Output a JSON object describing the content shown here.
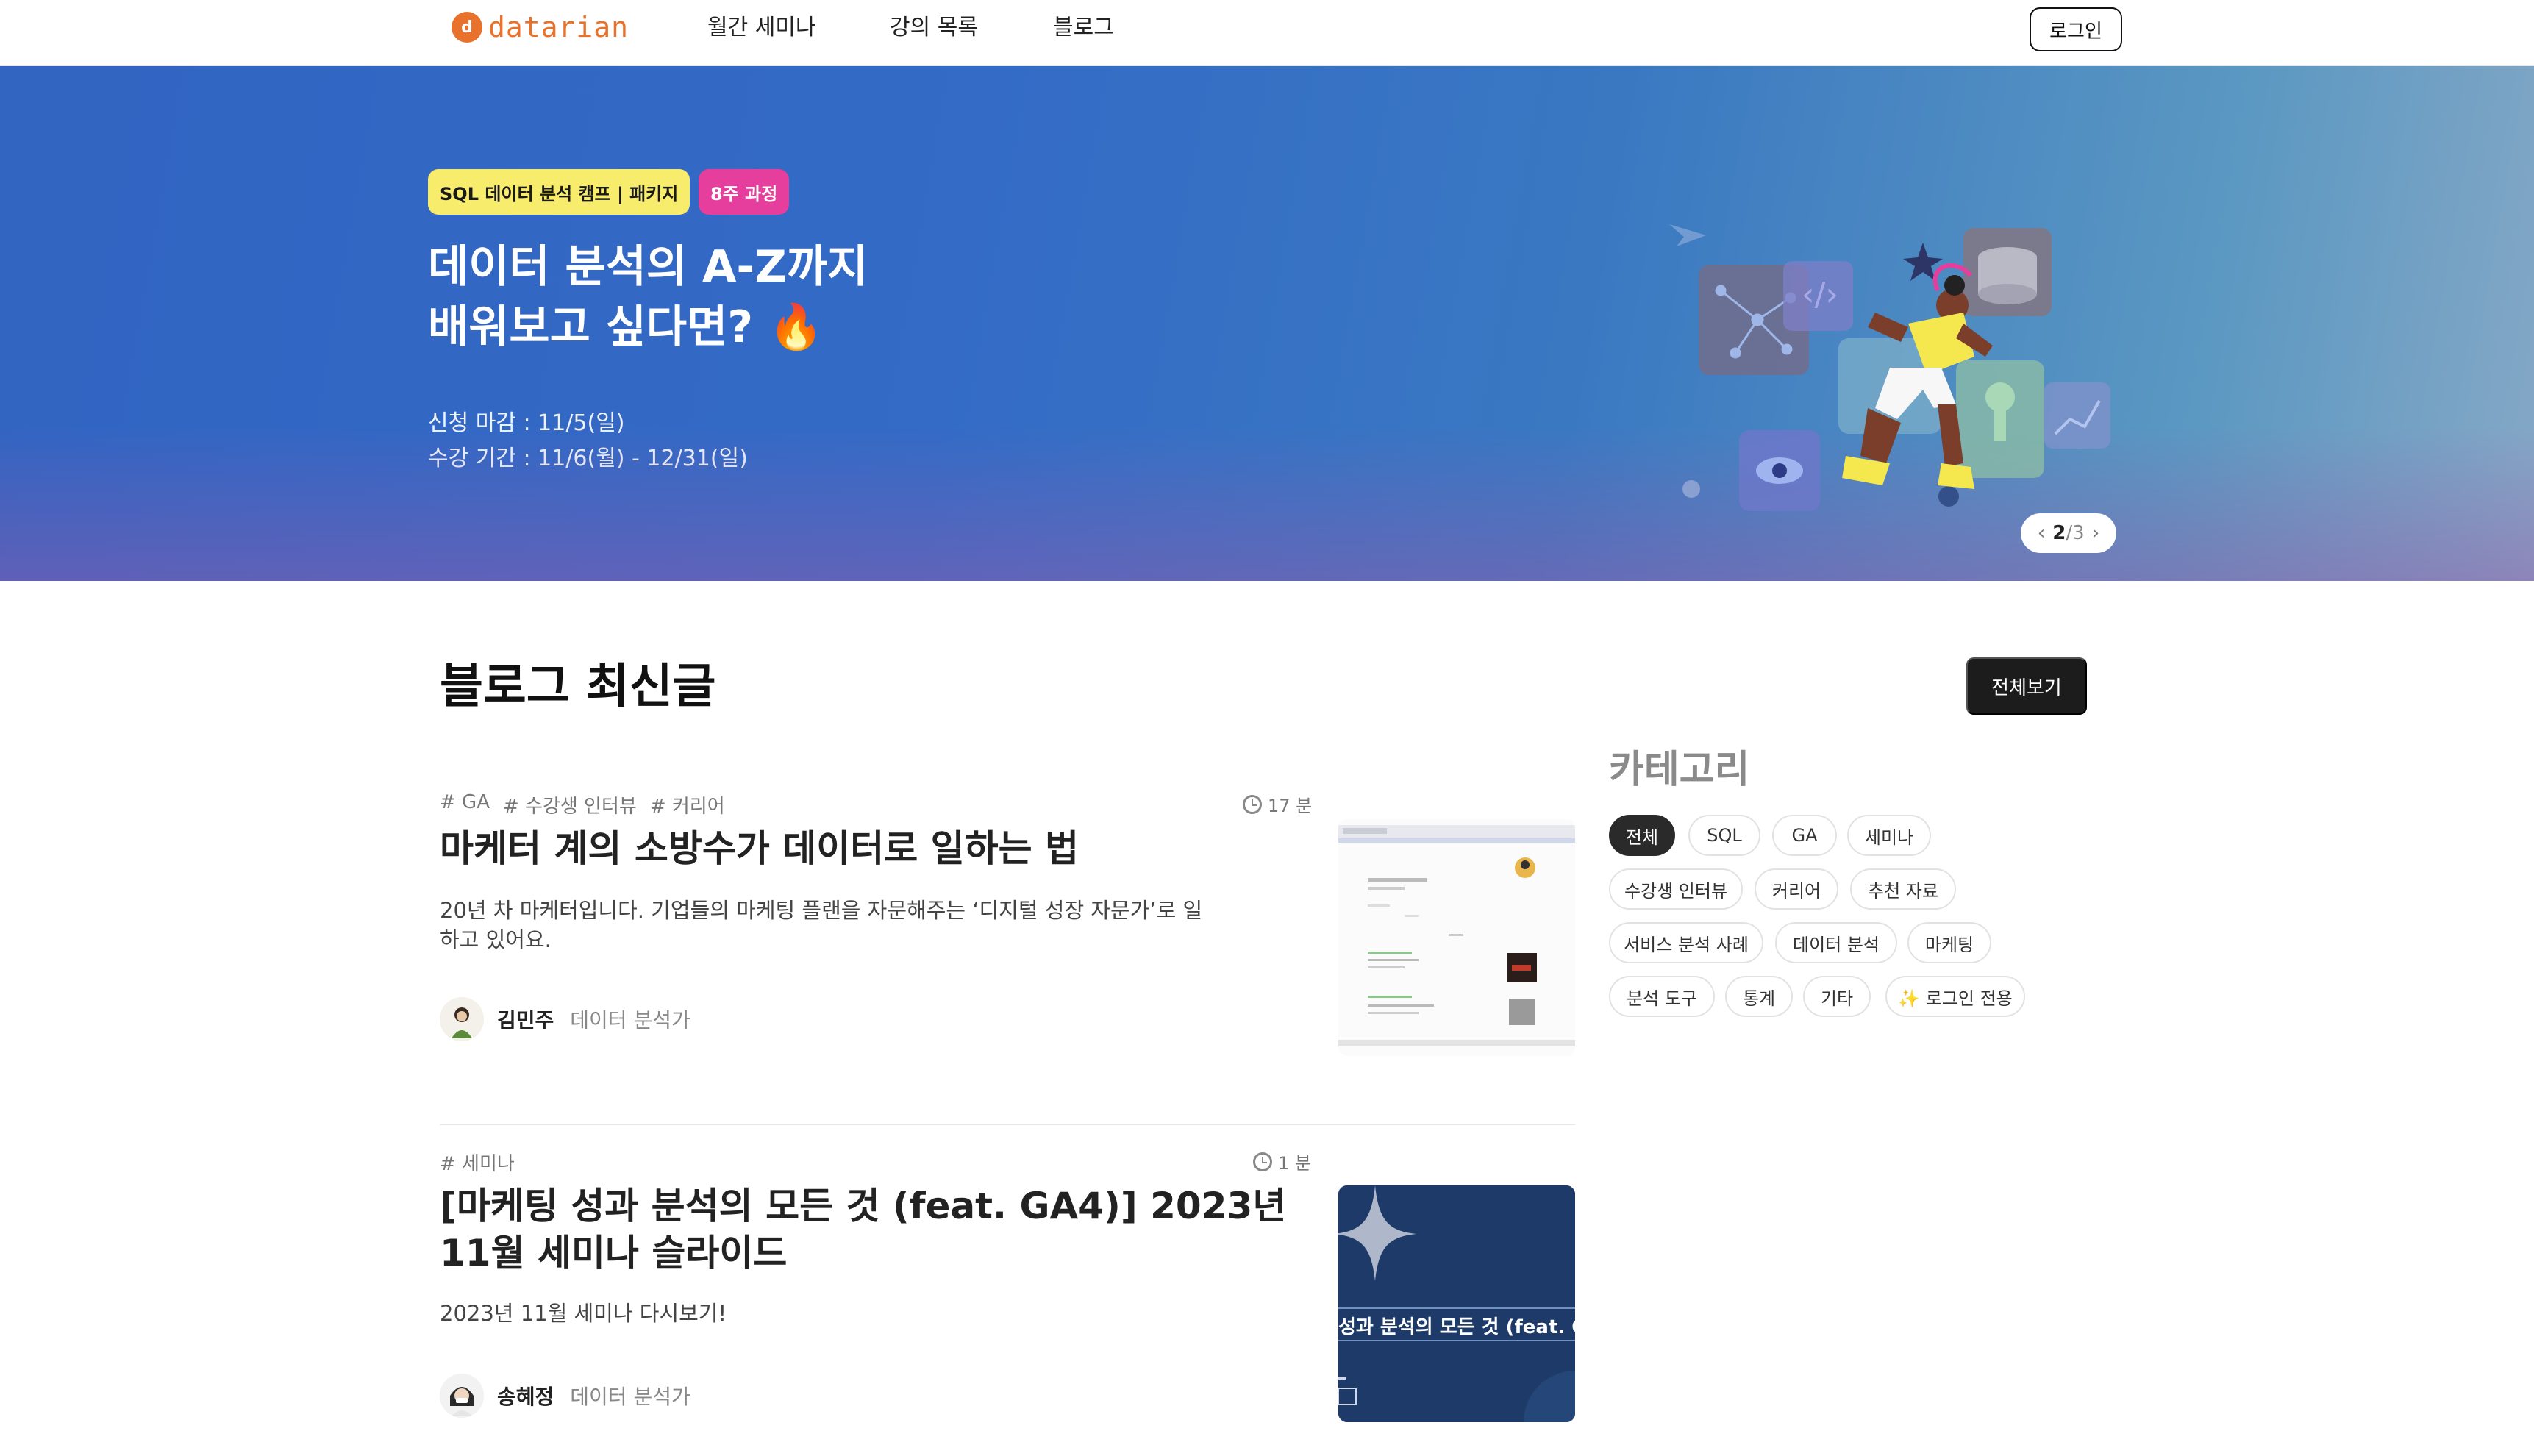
{
  "header": {
    "logo_text": "datarian",
    "nav": [
      "월간 세미나",
      "강의 목록",
      "블로그"
    ],
    "login_label": "로그인"
  },
  "hero": {
    "badge_course": "SQL 데이터 분석 캠프 | 패키지",
    "badge_weeks": "8주 과정",
    "title_line1": "데이터 분석의 A-Z까지",
    "title_line2": "배워보고 싶다면? 🔥",
    "deadline": "신청 마감 : 11/5(일)",
    "period": "수강 기간 : 11/6(월) - 12/31(일)",
    "pager_current": "2",
    "pager_sep": "/",
    "pager_total": "3"
  },
  "blog": {
    "section_title": "블로그 최신글",
    "view_all_label": "전체보기",
    "posts": [
      {
        "tags": [
          "# GA",
          "# 수강생 인터뷰",
          "# 커리어"
        ],
        "read_time": "17 분",
        "title": "마케터 계의 소방수가 데이터로 일하는 법",
        "desc": "20년 차 마케터입니다. 기업들의 마케팅 플랜을 자문해주는 ‘디지털 성장 자문가’로 일하고 있어요.",
        "author": "김민주",
        "role": "데이터 분석가"
      },
      {
        "tags": [
          "# 세미나"
        ],
        "read_time": "1 분",
        "title_line1": "[마케팅 성과 분석의 모든 것 (feat. GA4)] 2023년",
        "title_line2": "11월 세미나 슬라이드",
        "desc": "2023년 11월 세미나 다시보기!",
        "author": "송혜정",
        "role": "데이터 분석가",
        "thumb_text": "성과 분석의 모든 것 (feat. GA"
      }
    ]
  },
  "categories": {
    "title": "카테고리",
    "items": [
      "전체",
      "SQL",
      "GA",
      "세미나",
      "수강생 인터뷰",
      "커리어",
      "추천 자료",
      "서비스 분석 사례",
      "데이터 분석",
      "마케팅",
      "분석 도구",
      "통계",
      "기타",
      "✨ 로그인 전용"
    ],
    "active": "전체"
  },
  "colors": {
    "brand": "#e8722b",
    "hero_blue": "#336bc6",
    "badge_yellow": "#f7ec6b",
    "badge_pink": "#e53e9c",
    "chip_active": "#2a2a2a"
  }
}
